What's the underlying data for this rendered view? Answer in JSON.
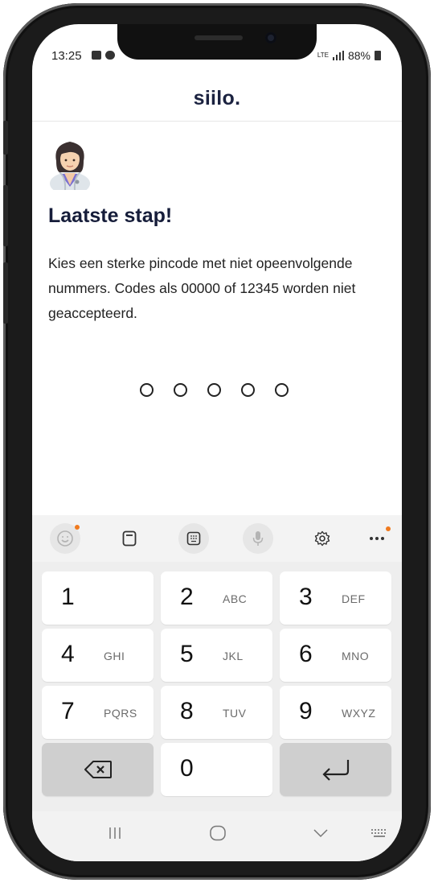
{
  "status_bar": {
    "time": "13:25",
    "network": "LTE",
    "battery": "88%"
  },
  "app": {
    "logo": "siilo."
  },
  "page": {
    "heading": "Laatste stap!",
    "description": "Kies een sterke pincode met niet opeenvolgende nummers. Codes als 00000 of 12345 worden niet geaccepteerd.",
    "avatar_icon": "doctor-woman-icon",
    "pin_length": 5,
    "pin_entered": 0
  },
  "keyboard_toolbar": [
    "emoji-icon",
    "clipboard-icon",
    "keypad-icon",
    "microphone-icon",
    "gear-icon",
    "more-icon"
  ],
  "keys": [
    {
      "num": "1",
      "letters": ""
    },
    {
      "num": "2",
      "letters": "ABC"
    },
    {
      "num": "3",
      "letters": "DEF"
    },
    {
      "num": "4",
      "letters": "GHI"
    },
    {
      "num": "5",
      "letters": "JKL"
    },
    {
      "num": "6",
      "letters": "MNO"
    },
    {
      "num": "7",
      "letters": "PQRS"
    },
    {
      "num": "8",
      "letters": "TUV"
    },
    {
      "num": "9",
      "letters": "WXYZ"
    },
    {
      "num": "",
      "letters": "",
      "icon": "backspace-icon"
    },
    {
      "num": "0",
      "letters": ""
    },
    {
      "num": "",
      "letters": "",
      "icon": "enter-icon"
    }
  ],
  "colors": {
    "heading": "#161d3a",
    "accent_dot": "#f07a1e"
  }
}
